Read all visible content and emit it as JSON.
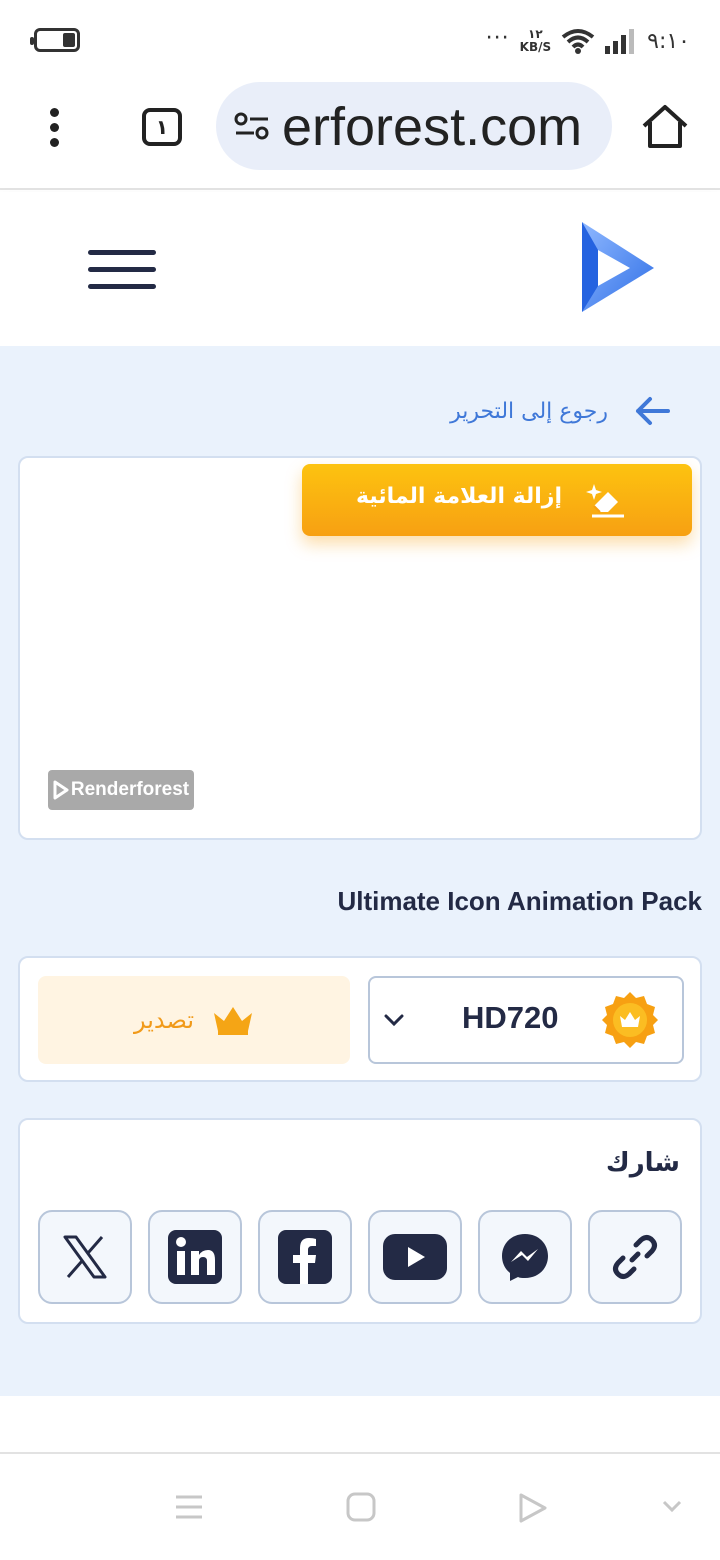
{
  "status_bar": {
    "time": "٩:١٠",
    "speed_value": "١٢",
    "speed_unit": "KB/S",
    "more_dots": "···"
  },
  "browser": {
    "url_text": "erforest.com",
    "tab_count": "١"
  },
  "back_link": {
    "label": "رجوع إلى التحرير"
  },
  "preview": {
    "remove_watermark_label": "إزالة العلامة المائية",
    "watermark_text": "Renderforest"
  },
  "project": {
    "title": "Ultimate Icon Animation Pack"
  },
  "export": {
    "button_label": "تصدير",
    "quality_value": "HD720"
  },
  "share": {
    "label": "شارك",
    "targets": [
      "x-icon",
      "linkedin-icon",
      "facebook-icon",
      "youtube-icon",
      "messenger-icon",
      "link-icon"
    ]
  },
  "colors": {
    "accent_blue": "#3f78d8",
    "gold": "#f7a012",
    "dark": "#232a45",
    "panel_bg": "#eaf2fc"
  }
}
